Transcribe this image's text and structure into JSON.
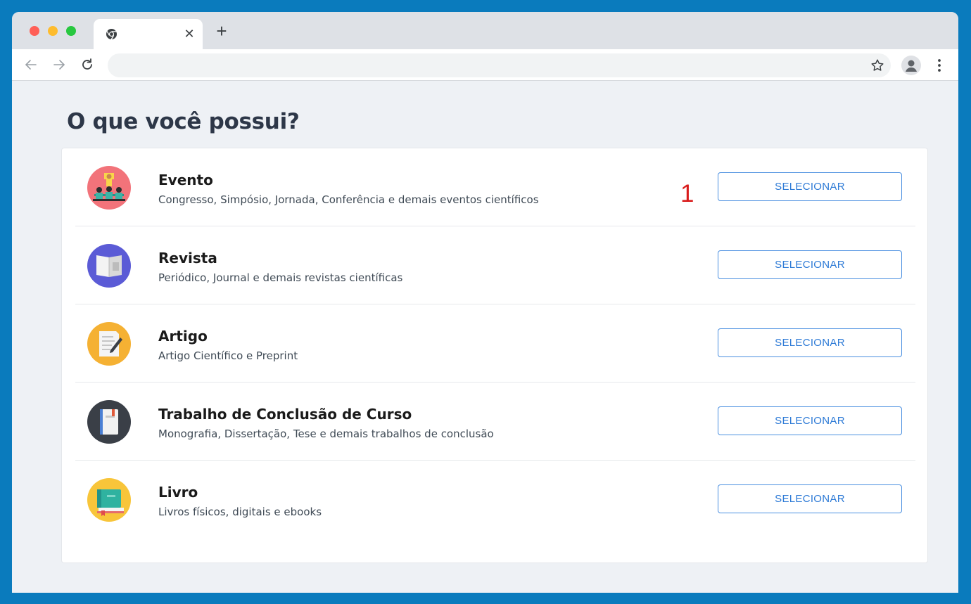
{
  "browser": {
    "tab": {
      "title": ""
    },
    "address_bar": {
      "value": ""
    }
  },
  "page": {
    "title": "O que você possui?",
    "items": [
      {
        "title": "Evento",
        "description": "Congresso, Simpósio, Jornada, Conferência e demais eventos científicos",
        "button": "SELECIONAR"
      },
      {
        "title": "Revista",
        "description": "Periódico, Journal e demais revistas científicas",
        "button": "SELECIONAR"
      },
      {
        "title": "Artigo",
        "description": "Artigo Científico e Preprint",
        "button": "SELECIONAR"
      },
      {
        "title": "Trabalho de Conclusão de Curso",
        "description": "Monografia, Dissertação, Tese e demais trabalhos de conclusão",
        "button": "SELECIONAR"
      },
      {
        "title": "Livro",
        "description": "Livros físicos, digitais e ebooks",
        "button": "SELECIONAR"
      }
    ],
    "annotation": "1"
  },
  "icons": {
    "event": "conference-icon",
    "magazine": "magazine-icon",
    "article": "article-icon",
    "thesis": "thesis-icon",
    "book": "book-icon"
  },
  "colors": {
    "accent": "#2d7ad6",
    "button_border": "#4a8fe0",
    "annotation": "#d91c1c",
    "event_bg": "#f2737a",
    "magazine_bg": "#5b5bd6",
    "article_bg": "#f5b133",
    "thesis_bg": "#3a3f47",
    "book_bg": "#f8c53a"
  }
}
